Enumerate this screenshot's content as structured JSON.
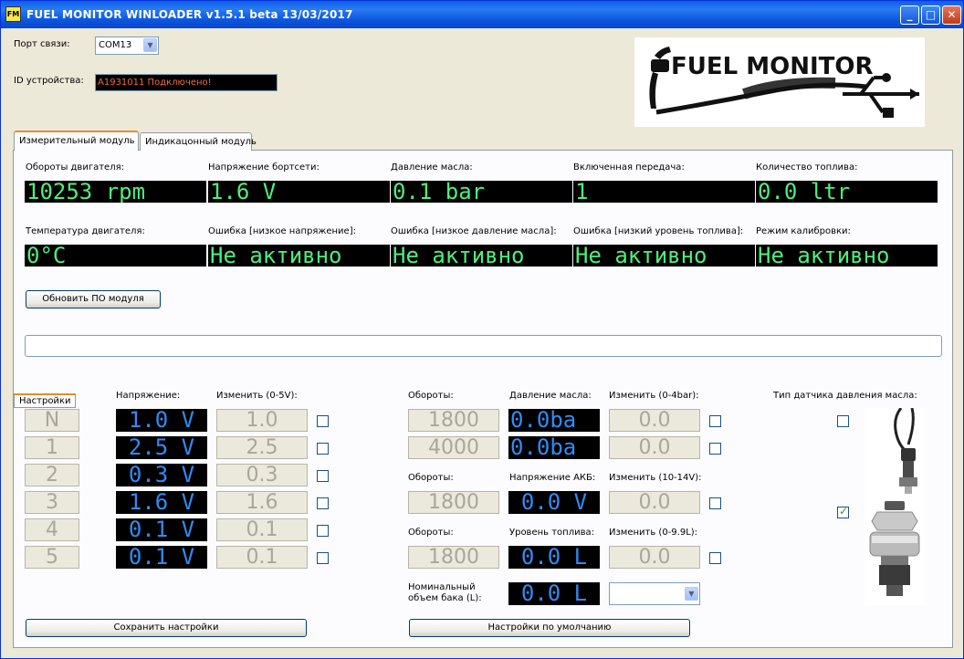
{
  "window": {
    "title": "FUEL MONITOR WINLOADER v1.5.1 beta 13/03/2017",
    "icon_text": "FM"
  },
  "port": {
    "label": "Порт связи:",
    "value": "COM13"
  },
  "device": {
    "label": "ID устройства:",
    "value": "A1931011 Подключено!"
  },
  "logo": {
    "text": "FUEL MONITOR",
    "url": "WWW.DRZ-CLUB.RU"
  },
  "tabs": [
    {
      "label": "Измерительный модуль"
    },
    {
      "label": "Индикацонный модуль"
    }
  ],
  "readings_row1": [
    {
      "label": "Обороты двигателя:",
      "value": "10253 rpm"
    },
    {
      "label": "Напряжение бортсети:",
      "value": "1.6 V"
    },
    {
      "label": "Давление масла:",
      "value": "0.1 bar"
    },
    {
      "label": "Включенная передача:",
      "value": "1"
    },
    {
      "label": "Количество топлива:",
      "value": "0.0 ltr"
    }
  ],
  "readings_row2": [
    {
      "label": "Температура двигателя:",
      "value": "0°C"
    },
    {
      "label": "Ошибка [низкое напряжение]:",
      "value": "Не активно"
    },
    {
      "label": "Ошибка [низкое давление масла]:",
      "value": "Не активно"
    },
    {
      "label": "Ошибка [низкий уровень топлива]:",
      "value": "Не активно"
    },
    {
      "label": "Режим калибровки:",
      "value": "Не активно"
    }
  ],
  "update_button": "Обновить ПО модуля",
  "settings": {
    "group_title": "Настройки",
    "voltage_header": "Напряжение:",
    "change_header": "Изменить (0-5V):",
    "gears": [
      {
        "gear": "N",
        "voltage": "1.0 V",
        "change": "1.0",
        "checked": false
      },
      {
        "gear": "1",
        "voltage": "2.5 V",
        "change": "2.5",
        "checked": false
      },
      {
        "gear": "2",
        "voltage": "0.3 V",
        "change": "0.3",
        "checked": false
      },
      {
        "gear": "3",
        "voltage": "1.6 V",
        "change": "1.6",
        "checked": false
      },
      {
        "gear": "4",
        "voltage": "0.1 V",
        "change": "0.1",
        "checked": false
      },
      {
        "gear": "5",
        "voltage": "0.1 V",
        "change": "0.1",
        "checked": false
      }
    ],
    "oil": {
      "rpm_header": "Обороты:",
      "value_header": "Давление масла:",
      "change_header": "Изменить (0-4bar):",
      "rows": [
        {
          "rpm": "1800",
          "value": "0.0ba",
          "change": "0.0",
          "checked": false
        },
        {
          "rpm": "4000",
          "value": "0.0ba",
          "change": "0.0",
          "checked": false
        }
      ]
    },
    "battery": {
      "rpm_header": "Обороты:",
      "value_header": "Напряжение АКБ:",
      "change_header": "Изменить (10-14V):",
      "rpm": "1800",
      "value": "0.0 V",
      "change": "0.0",
      "checked": false
    },
    "fuel": {
      "rpm_header": "Обороты:",
      "value_header": "Уровень топлива:",
      "change_header": "Изменить (0-9.9L):",
      "rpm": "1800",
      "value": "0.0 L",
      "change": "0.0",
      "checked": false
    },
    "tank": {
      "label": "Номинальный объем бака (L):",
      "value": "0.0 L",
      "select_value": ""
    },
    "sensor_type": {
      "label": "Тип датчика давления масла:",
      "option1_checked": false,
      "option2_checked": true
    },
    "save_button": "Сохранить настройки",
    "defaults_button": "Настройки по умолчанию"
  }
}
